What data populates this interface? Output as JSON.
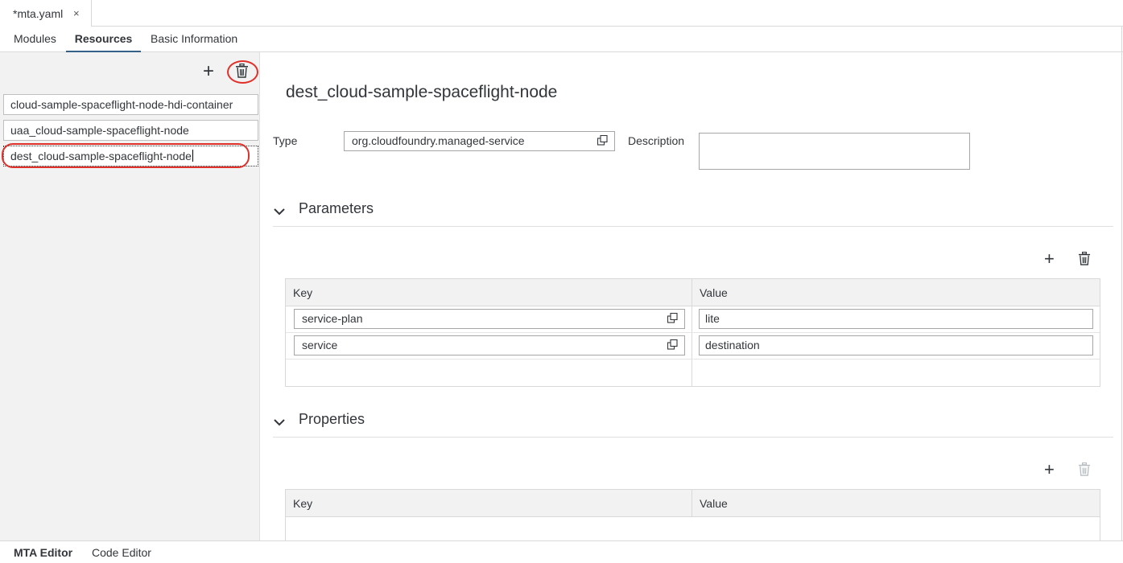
{
  "file_tab": {
    "modified_marker": "*",
    "name": "mta.yaml",
    "close": "×"
  },
  "editor_tabs": [
    "Modules",
    "Resources",
    "Basic Information"
  ],
  "active_editor_tab": "Resources",
  "left_toolbar": {
    "add": "+",
    "delete_icon": "trash-icon"
  },
  "resources": [
    {
      "name": "cloud-sample-spaceflight-node-hdi-container",
      "selected": false
    },
    {
      "name": "uaa_cloud-sample-spaceflight-node",
      "selected": false
    },
    {
      "name": "dest_cloud-sample-spaceflight-node",
      "selected": true
    }
  ],
  "detail": {
    "title": "dest_cloud-sample-spaceflight-node",
    "type_label": "Type",
    "type_value": "org.cloudfoundry.managed-service",
    "description_label": "Description",
    "description_value": ""
  },
  "parameters": {
    "title": "Parameters",
    "add": "+",
    "columns": [
      "Key",
      "Value"
    ],
    "rows": [
      {
        "key": "service-plan",
        "value": "lite"
      },
      {
        "key": "service",
        "value": "destination"
      }
    ]
  },
  "properties": {
    "title": "Properties",
    "add": "+",
    "delete_disabled": true,
    "columns": [
      "Key",
      "Value"
    ],
    "rows": []
  },
  "bottom_tabs": [
    "MTA Editor",
    "Code Editor"
  ],
  "active_bottom_tab": "MTA Editor",
  "colors": {
    "accent": "#346187",
    "highlight": "#e0302a",
    "pane_bg": "#f2f2f2"
  }
}
